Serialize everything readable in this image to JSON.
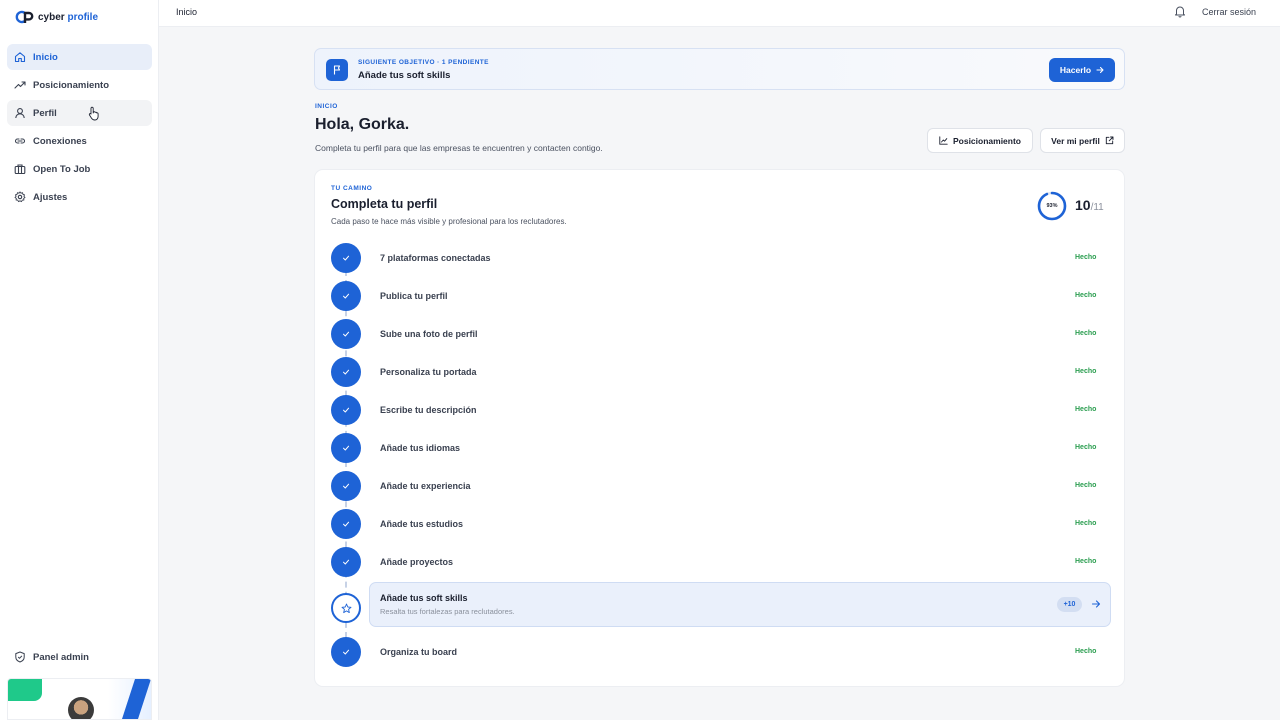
{
  "app": {
    "logo_main": "cyber",
    "logo_accent": "profile"
  },
  "sidebar": {
    "items": [
      {
        "label": "Inicio",
        "icon": "home-icon",
        "state": "active"
      },
      {
        "label": "Posicionamiento",
        "icon": "trending-icon"
      },
      {
        "label": "Perfil",
        "icon": "user-icon",
        "state": "hover"
      },
      {
        "label": "Conexiones",
        "icon": "link-icon"
      },
      {
        "label": "Open To Job",
        "icon": "briefcase-icon"
      },
      {
        "label": "Ajustes",
        "icon": "gear-icon"
      }
    ],
    "admin_label": "Panel admin"
  },
  "topbar": {
    "breadcrumb": "Inicio",
    "logout": "Cerrar sesión"
  },
  "objective": {
    "eyebrow": "SIGUIENTE OBJETIVO · 1 PENDIENTE",
    "title": "Añade tus soft skills",
    "button": "Hacerlo"
  },
  "greeting": {
    "eyebrow": "INICIO",
    "title": "Hola, Gorka.",
    "subtitle": "Completa tu perfil para que las empresas te encuentren y contacten contigo.",
    "btn_positioning": "Posicionamiento",
    "btn_view_profile": "Ver mi perfil"
  },
  "path": {
    "eyebrow": "TU CAMINO",
    "title": "Completa tu perfil",
    "subtitle": "Cada paso te hace más visible y profesional para los reclutadores.",
    "percent_label": "93%",
    "percent_value": 0.93,
    "completed": "10",
    "total": "/11",
    "done_label": "Hecho",
    "current": {
      "label": "Añade tus soft skills",
      "desc": "Resalta tus fortalezas para reclutadores.",
      "points": "+10"
    },
    "steps": [
      {
        "label": "7 plataformas conectadas",
        "status": "Hecho"
      },
      {
        "label": "Publica tu perfil",
        "status": "Hecho"
      },
      {
        "label": "Sube una foto de perfil",
        "status": "Hecho"
      },
      {
        "label": "Personaliza tu portada",
        "status": "Hecho"
      },
      {
        "label": "Escribe tu descripción",
        "status": "Hecho"
      },
      {
        "label": "Añade tus idiomas",
        "status": "Hecho"
      },
      {
        "label": "Añade tu experiencia",
        "status": "Hecho"
      },
      {
        "label": "Añade tus estudios",
        "status": "Hecho"
      },
      {
        "label": "Añade proyectos",
        "status": "Hecho"
      },
      {
        "label": "Organiza tu board",
        "status": "Hecho"
      }
    ]
  },
  "colors": {
    "accent": "#1e63d6",
    "done": "#2a9d4f"
  }
}
